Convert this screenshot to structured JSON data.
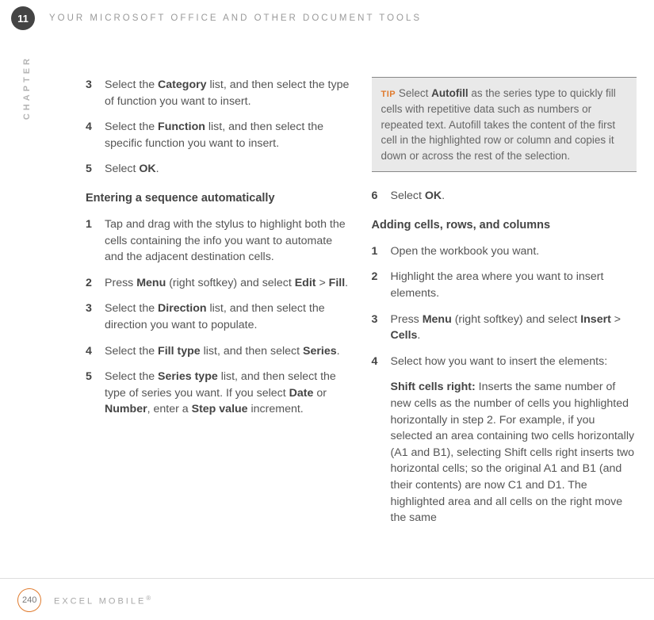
{
  "header": {
    "chapter_num": "11",
    "chapter_label_vert": "CHAPTER",
    "title": "YOUR MICROSOFT OFFICE AND OTHER DOCUMENT TOOLS"
  },
  "left": {
    "steps_a": [
      {
        "n": "3",
        "pre": "Select the ",
        "b1": "Category",
        "post": " list, and then select the type of function you want to insert."
      },
      {
        "n": "4",
        "pre": "Select the ",
        "b1": "Function",
        "post": " list, and then select the specific function you want to insert."
      },
      {
        "n": "5",
        "pre": "Select ",
        "b1": "OK",
        "post": "."
      }
    ],
    "subhead_b": "Entering a sequence automatically",
    "steps_b": {
      "s1": {
        "n": "1",
        "text": "Tap and drag with the stylus to highlight both the cells containing the info you want to automate and the adjacent destination cells."
      },
      "s2": {
        "n": "2",
        "pre": "Press ",
        "b1": "Menu",
        "mid": " (right softkey) and select ",
        "b2": "Edit",
        "gt": " > ",
        "b3": "Fill",
        "post": "."
      },
      "s3": {
        "n": "3",
        "pre": "Select the ",
        "b1": "Direction",
        "post": " list, and then select the direction you want to populate."
      },
      "s4": {
        "n": "4",
        "pre": "Select the ",
        "b1": "Fill type",
        "mid": " list, and then select ",
        "b2": "Series",
        "post": "."
      },
      "s5": {
        "n": "5",
        "pre": "Select the ",
        "b1": "Series type",
        "mid1": " list, and then select the type of series you want. If you select ",
        "b2": "Date",
        "or": " or ",
        "b3": "Number",
        "mid2": ", enter a ",
        "b4": "Step value",
        "post": " increment."
      }
    }
  },
  "right": {
    "tip": {
      "label": "TIP",
      "pre": " Select ",
      "b1": "Autofill",
      "post": " as the series type to quickly fill cells with repetitive data such as numbers or repeated text. Autofill takes the content of the first cell in the highlighted row or column and copies it down or across the rest of the selection."
    },
    "step6": {
      "n": "6",
      "pre": "Select ",
      "b1": "OK",
      "post": "."
    },
    "subhead_c": "Adding cells, rows, and columns",
    "steps_c": {
      "s1": {
        "n": "1",
        "text": "Open the workbook you want."
      },
      "s2": {
        "n": "2",
        "text": "Highlight the area where you want to insert elements."
      },
      "s3": {
        "n": "3",
        "pre": "Press ",
        "b1": "Menu",
        "mid": " (right softkey) and select ",
        "b2": "Insert",
        "gt": " > ",
        "b3": "Cells",
        "post": "."
      },
      "s4": {
        "n": "4",
        "text": "Select how you want to insert the elements:"
      }
    },
    "shift": {
      "b1": "Shift cells right:",
      "post": " Inserts the same number of new cells as the number of cells you highlighted horizontally in step 2. For example, if you selected an area containing two cells horizontally (A1 and B1), selecting Shift cells right inserts two horizontal cells; so the original A1 and B1 (and their contents) are now C1 and D1. The highlighted area and all cells on the right move the same"
    }
  },
  "footer": {
    "page": "240",
    "title_pre": "EXCEL MOBILE",
    "reg": "®"
  }
}
